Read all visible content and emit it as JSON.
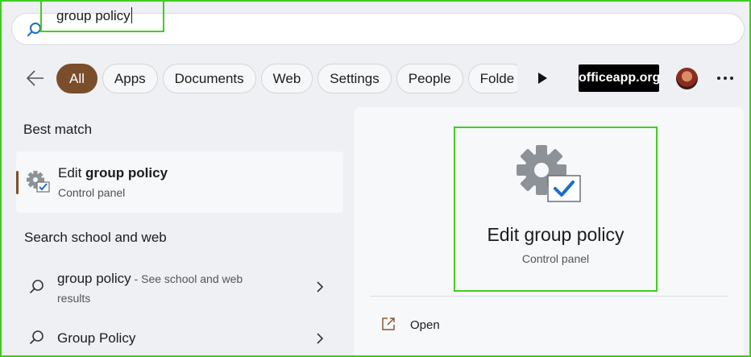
{
  "search": {
    "query": "group policy"
  },
  "filters": {
    "chips": [
      {
        "label": "All",
        "active": true
      },
      {
        "label": "Apps",
        "active": false
      },
      {
        "label": "Documents",
        "active": false
      },
      {
        "label": "Web",
        "active": false
      },
      {
        "label": "Settings",
        "active": false
      },
      {
        "label": "People",
        "active": false
      },
      {
        "label": "Folde",
        "active": false
      }
    ],
    "brand_badge": "officeapp.org"
  },
  "best_match": {
    "heading": "Best match",
    "title_prefix": "Edit ",
    "title_bold": "group policy",
    "subtitle": "Control panel"
  },
  "web_search": {
    "heading": "Search school and web",
    "rows": [
      {
        "query": "group policy",
        "hint": " - See school and web",
        "hint_line2": "results"
      },
      {
        "query": "Group Policy"
      }
    ]
  },
  "preview": {
    "title": "Edit group policy",
    "subtitle": "Control panel",
    "actions": [
      {
        "label": "Open",
        "icon": "open-external-icon"
      }
    ]
  },
  "colors": {
    "accent": "#7a4e2b",
    "highlight": "#3fce1e",
    "check_blue": "#1b6ecf"
  }
}
